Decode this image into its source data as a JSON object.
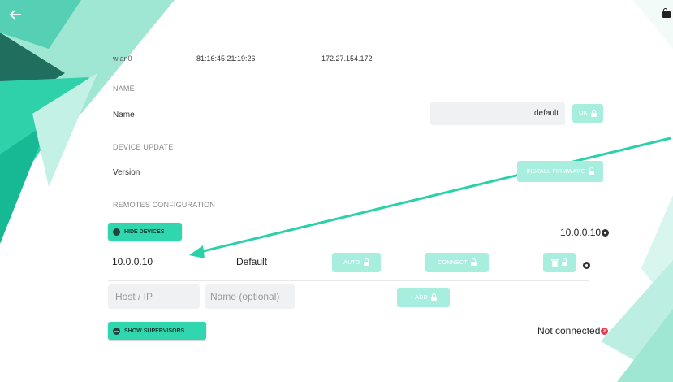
{
  "header": {
    "back_icon": "arrow-left-icon",
    "lock_icon": "lock-icon"
  },
  "interface": {
    "name": "wlan0",
    "mac": "81:16:45:21:19:26",
    "ip": "172.27.154.172"
  },
  "name_section": {
    "label": "NAME",
    "field_label": "Name",
    "value": "default",
    "ok_label": "OK"
  },
  "update_section": {
    "label": "DEVICE UPDATE",
    "field_label": "Version",
    "install_label": "INSTALL FIRMWARE"
  },
  "remotes_section": {
    "label": "REMOTES CONFIGURATION",
    "hide_devices_label": "HIDE DEVICES",
    "active_host": "10.0.0.10",
    "device_host": "10.0.0.10",
    "device_name": "Default",
    "auto_label": "AUTO",
    "connect_label": "CONNECT",
    "host_placeholder": "Host / IP",
    "name_placeholder": "Name (optional)",
    "add_label": "+ ADD",
    "show_supervisors_label": "SHOW SUPERVISORS",
    "status": "Not connected"
  },
  "colors": {
    "accent": "#2fd6ae",
    "accent_disabled": "#a8eede",
    "error": "#e04050"
  }
}
